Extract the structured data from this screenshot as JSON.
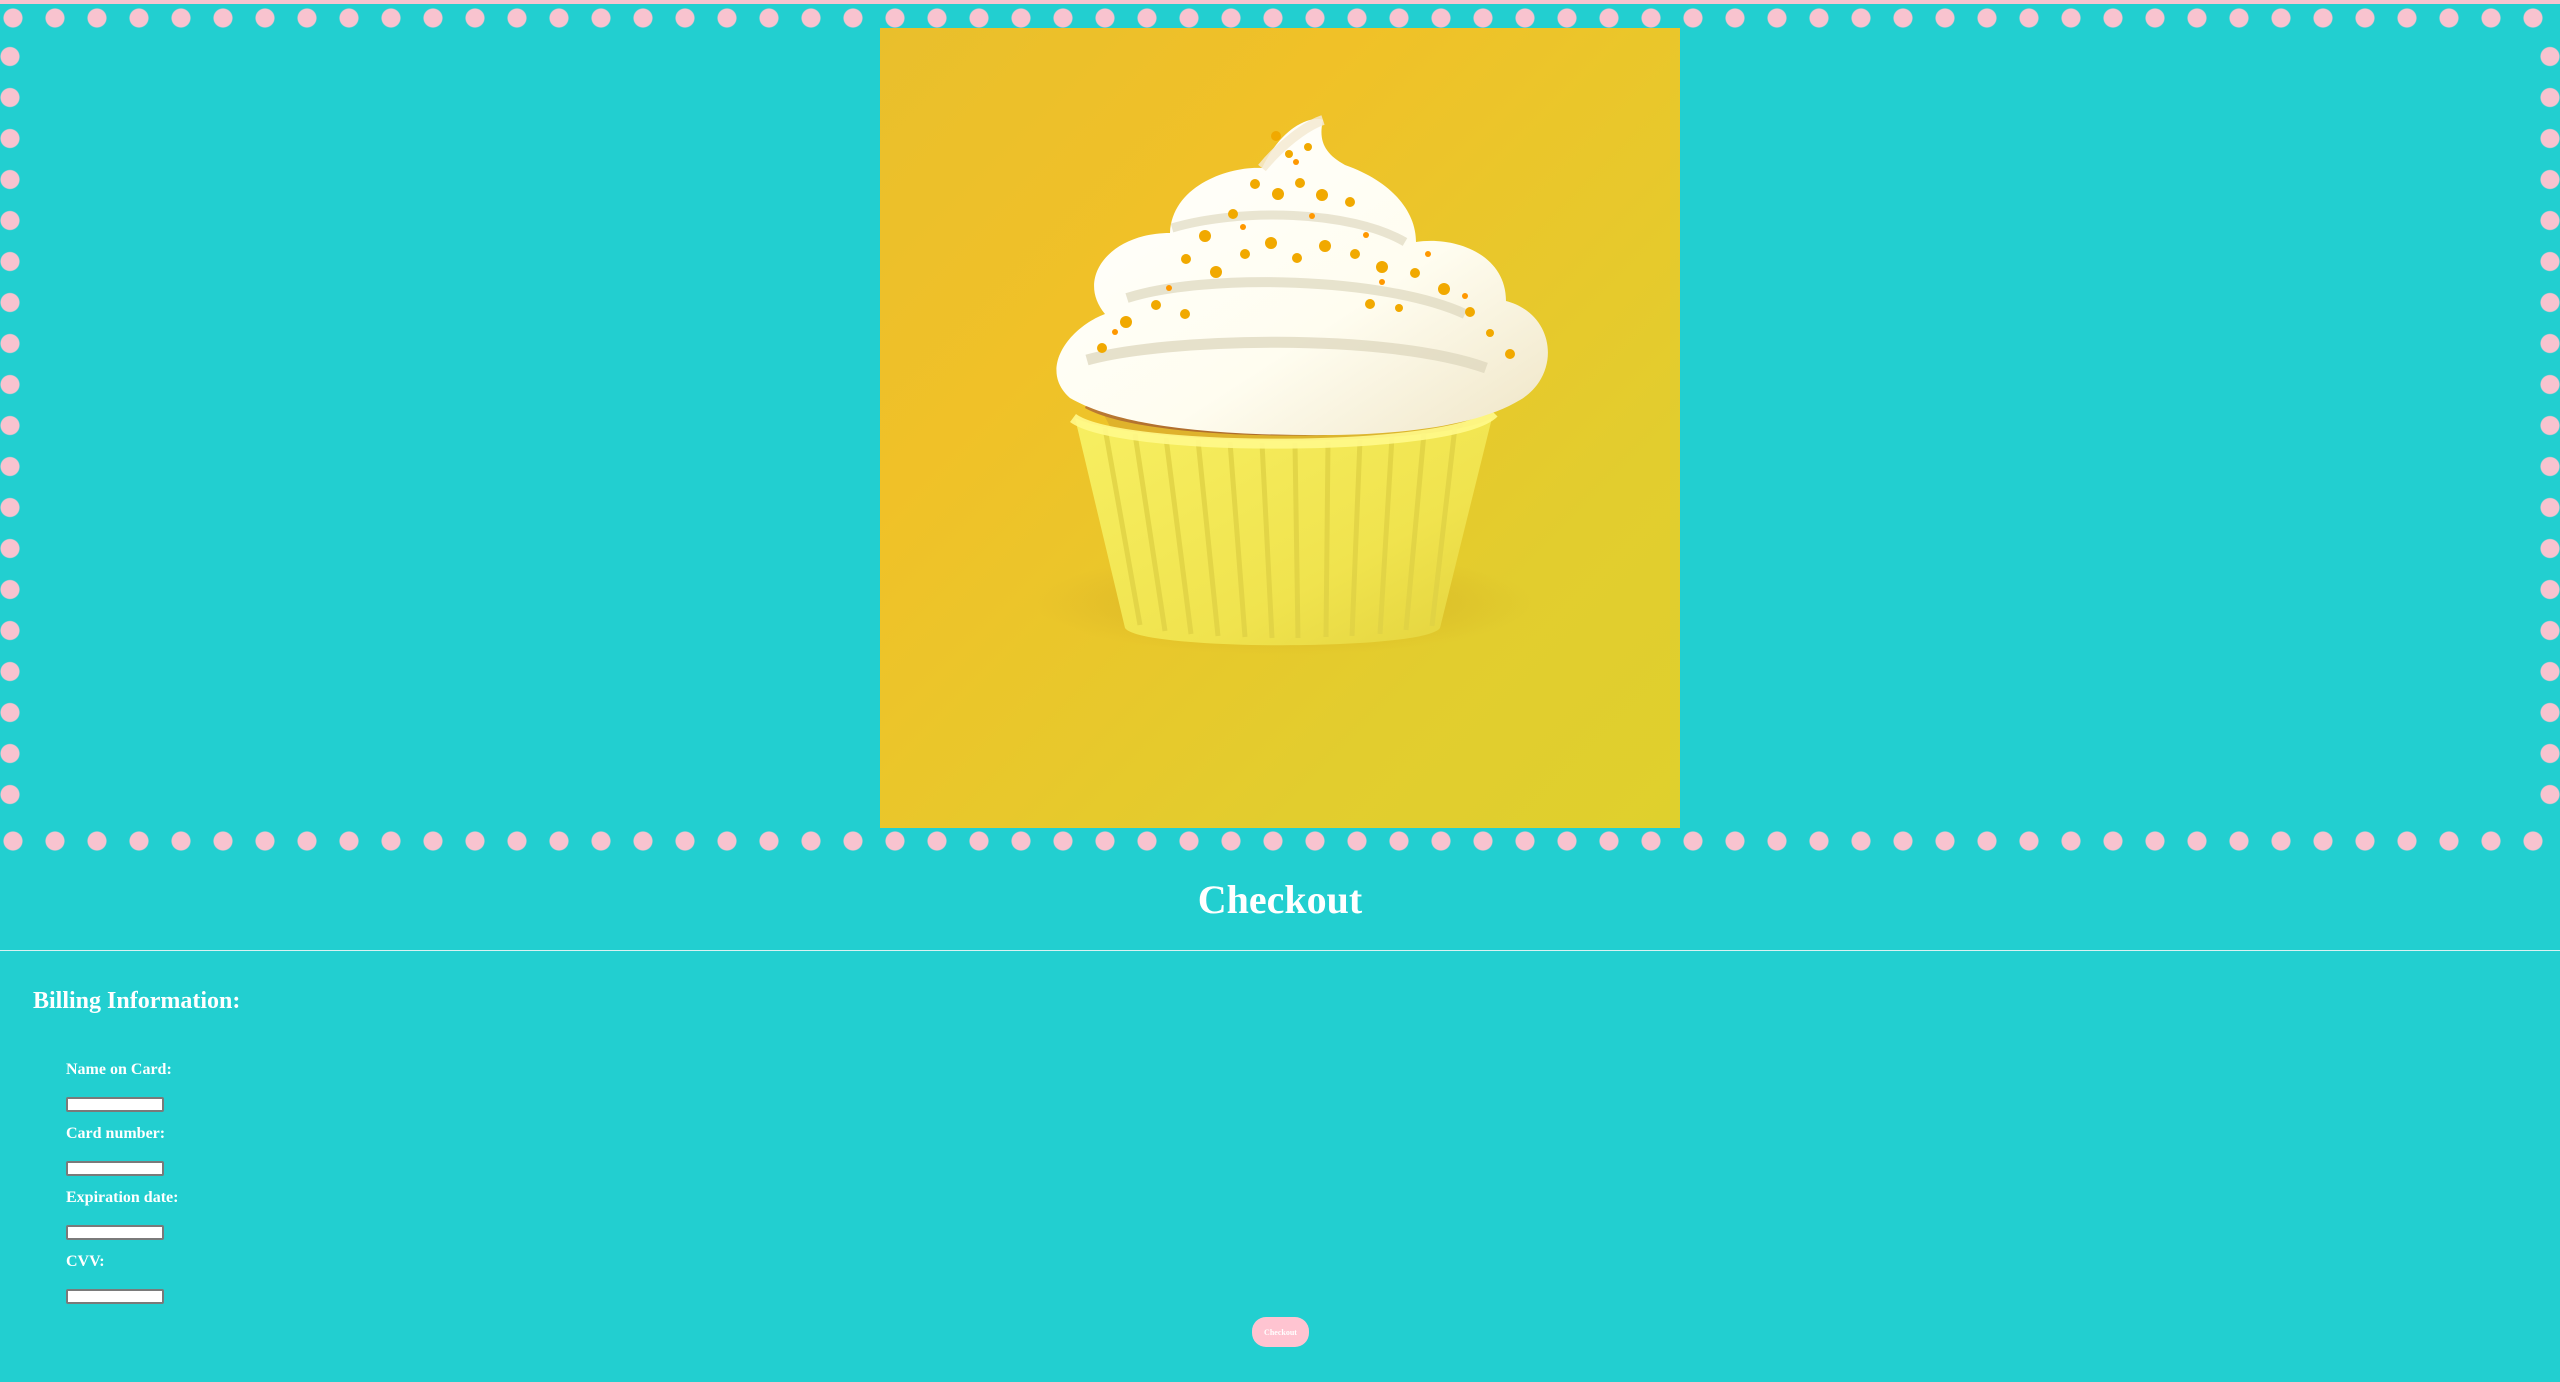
{
  "hero": {
    "image_subject": "cupcake-photo",
    "background_color": "#22cfd0",
    "border_dot_color": "#f8c3cf"
  },
  "page": {
    "title": "Checkout"
  },
  "billing": {
    "title": "Billing Information:",
    "fields": [
      {
        "label": "Name on Card:",
        "value": "",
        "placeholder": ""
      },
      {
        "label": "Card number:",
        "value": "",
        "placeholder": ""
      },
      {
        "label": "Expiration date:",
        "value": "",
        "placeholder": ""
      },
      {
        "label": "CVV:",
        "value": "",
        "placeholder": ""
      }
    ]
  },
  "actions": {
    "checkout_label": "Checkout",
    "button_color": "#ffc4d1"
  }
}
